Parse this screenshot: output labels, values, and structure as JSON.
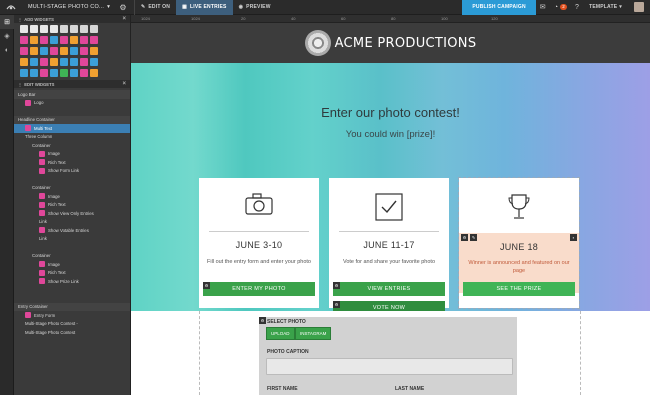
{
  "topbar": {
    "title": "MULTI-STAGE PHOTO CO...",
    "edit_on": "EDIT ON",
    "live_entries": "LIVE ENTRIES",
    "preview": "PREVIEW",
    "publish": "PUBLISH CAMPAIGN",
    "badge_count": "2",
    "template": "TEMPLATE"
  },
  "panel": {
    "add_widgets": "ADD WIDGETS",
    "edit_widgets": "EDIT WIDGETS",
    "tree": [
      {
        "label": "Logo Bar",
        "level": 0,
        "icon": "",
        "hdr": true
      },
      {
        "label": "Logo",
        "level": 1,
        "icon": "#e0479a"
      },
      {
        "label": "",
        "level": 0,
        "icon": ""
      },
      {
        "label": "Headline Container",
        "level": 0,
        "icon": "",
        "hdr": true
      },
      {
        "label": "Multi Text",
        "level": 1,
        "icon": "#e0479a",
        "sel": true
      },
      {
        "label": "Three Column",
        "level": 1,
        "icon": ""
      },
      {
        "label": "Container",
        "level": 2,
        "icon": ""
      },
      {
        "label": "Image",
        "level": 3,
        "icon": "#e0479a"
      },
      {
        "label": "Rich Text",
        "level": 3,
        "icon": "#e0479a"
      },
      {
        "label": "Show Form Link",
        "level": 3,
        "icon": "#e0479a"
      },
      {
        "label": "",
        "level": 0,
        "icon": ""
      },
      {
        "label": "Container",
        "level": 2,
        "icon": ""
      },
      {
        "label": "Image",
        "level": 3,
        "icon": "#e0479a"
      },
      {
        "label": "Rich Text",
        "level": 3,
        "icon": "#e0479a"
      },
      {
        "label": "Show View Only Entries",
        "level": 3,
        "icon": "#e0479a"
      },
      {
        "label": "Link",
        "level": 3,
        "icon": ""
      },
      {
        "label": "Show Votable Entries",
        "level": 3,
        "icon": "#e0479a"
      },
      {
        "label": "Link",
        "level": 3,
        "icon": ""
      },
      {
        "label": "",
        "level": 0,
        "icon": ""
      },
      {
        "label": "Container",
        "level": 2,
        "icon": ""
      },
      {
        "label": "Image",
        "level": 3,
        "icon": "#e0479a"
      },
      {
        "label": "Rich Text",
        "level": 3,
        "icon": "#e0479a"
      },
      {
        "label": "Show Prize Link",
        "level": 3,
        "icon": "#e0479a"
      },
      {
        "label": "",
        "level": 0,
        "icon": ""
      },
      {
        "label": "",
        "level": 0,
        "icon": ""
      },
      {
        "label": "Entry Container",
        "level": 0,
        "icon": "",
        "hdr": true
      },
      {
        "label": "Entry Form",
        "level": 1,
        "icon": "#e0479a"
      },
      {
        "label": "Multi-Stage Photo Contest -",
        "level": 1,
        "icon": ""
      },
      {
        "label": "Multi-Stage Photo Contest",
        "level": 1,
        "icon": ""
      }
    ]
  },
  "ruler": {
    "ticks": [
      "1024",
      "1024",
      "20",
      "40",
      "60",
      "80",
      "100",
      "120"
    ]
  },
  "hero": {
    "brand": "ACME PRODUCTIONS",
    "title": "Enter our photo contest!",
    "subtitle": "You could win [prize]!"
  },
  "cards": [
    {
      "date": "JUNE 3-10",
      "desc": "Fill out the entry form and enter your photo",
      "buttons": [
        "ENTER MY PHOTO"
      ],
      "icon": "camera-icon"
    },
    {
      "date": "JUNE 11-17",
      "desc": "Vote for and share your favorite photo",
      "buttons": [
        "VIEW ENTRIES",
        "VOTE NOW"
      ],
      "icon": "checkbox-icon"
    },
    {
      "date": "JUNE 18",
      "desc": "Winner is announced and featured on our page",
      "buttons": [
        "SEE THE PRIZE"
      ],
      "icon": "trophy-icon"
    }
  ],
  "form": {
    "select_photo": "SELECT PHOTO",
    "upload": "UPLOAD",
    "instagram": "INSTAGRAM",
    "photo_caption": "PHOTO CAPTION",
    "first_name": "FIRST NAME",
    "last_name": "LAST NAME"
  },
  "colors": {
    "accent": "#2b9bd6",
    "green": "#3aa24a",
    "selected": "#3b7fb4",
    "peach": "#f9dccb"
  }
}
